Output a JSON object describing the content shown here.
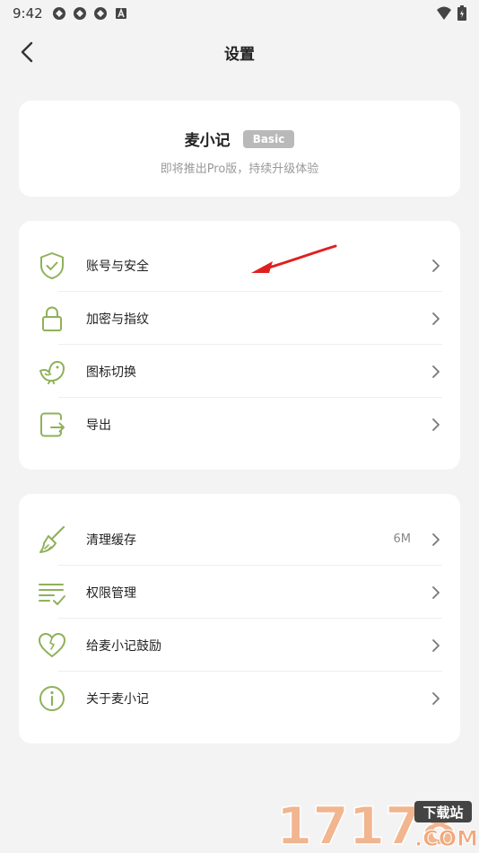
{
  "status_bar": {
    "time": "9:42"
  },
  "header": {
    "title": "设置"
  },
  "profile": {
    "name": "麦小记",
    "badge": "Basic",
    "subtitle": "即将推出Pro版，持续升级体验"
  },
  "group1": {
    "items": [
      {
        "label": "账号与安全",
        "icon": "shield-check-icon"
      },
      {
        "label": "加密与指纹",
        "icon": "lock-icon"
      },
      {
        "label": "图标切换",
        "icon": "bird-icon"
      },
      {
        "label": "导出",
        "icon": "export-icon"
      }
    ]
  },
  "group2": {
    "items": [
      {
        "label": "清理缓存",
        "value": "6M",
        "icon": "broom-icon"
      },
      {
        "label": "权限管理",
        "icon": "list-check-icon"
      },
      {
        "label": "给麦小记鼓励",
        "icon": "heart-icon"
      },
      {
        "label": "关于麦小记",
        "icon": "info-icon"
      }
    ]
  },
  "watermark": {
    "text": "17178",
    "badge": "下载站",
    "suffix": ".COM"
  },
  "colors": {
    "accent": "#8fb15a",
    "background": "#f3f3f3",
    "annotation": "#e0201e"
  }
}
